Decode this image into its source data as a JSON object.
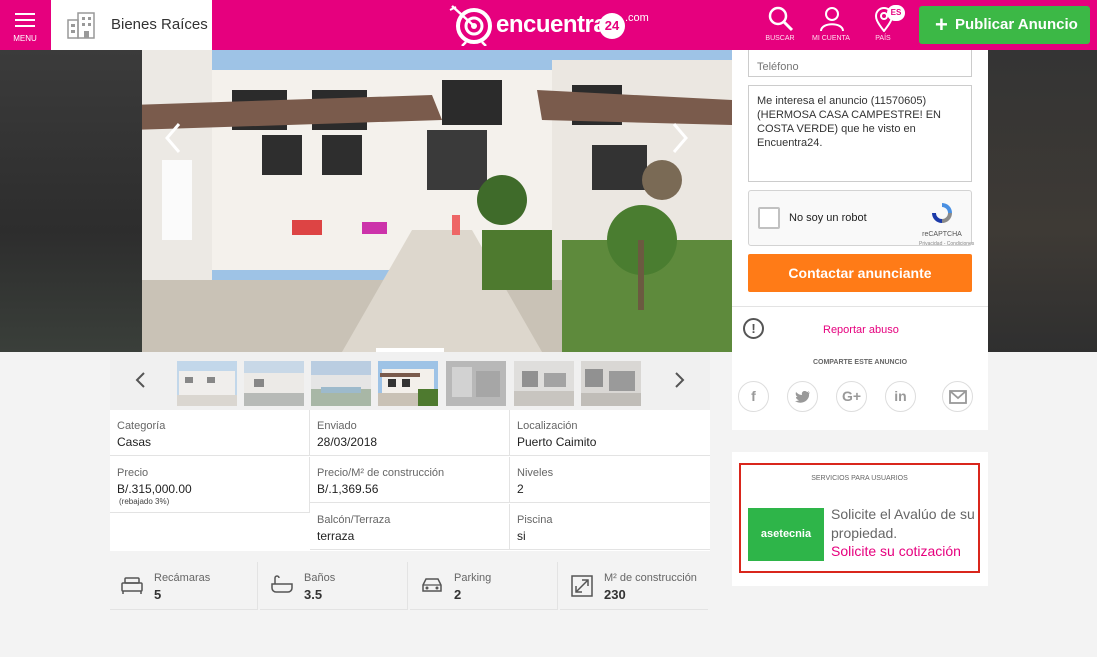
{
  "topbar": {
    "menu_label": "MENU",
    "category": "Bienes Raíces",
    "logo_word": "encuentra",
    "logo_number": "24",
    "logo_suffix": ".com",
    "search_label": "BUSCAR",
    "account_label": "MI CUENTA",
    "country_label": "PAÍS",
    "language": "ES",
    "publish_label": "Publicar Anuncio",
    "brand_color": "#e6007e"
  },
  "contact_form": {
    "phone_placeholder": "Teléfono",
    "message": "Me interesa el anuncio (11570605) (HERMOSA CASA CAMPESTRE!  EN COSTA VERDE) que he visto en Encuentra24.",
    "captcha_label": "No soy un robot",
    "captcha_brand": "reCAPTCHA",
    "captcha_links": "Privacidad - Condiciones",
    "contact_button": "Contactar anunciante",
    "report_link": "Reportar abuso"
  },
  "share": {
    "title": "COMPARTE ESTE ANUNCIO",
    "buttons": [
      "facebook-icon",
      "twitter-icon",
      "google-plus-icon",
      "linkedin-icon",
      "email-icon"
    ]
  },
  "services": {
    "title": "SERVICIOS PARA USUARIOS",
    "partner": "asetecnia",
    "description": "Solicite el Avalúo de su propiedad.",
    "cta": "Solicite su cotización"
  },
  "details": {
    "rows": [
      [
        {
          "label": "Categoría",
          "value": "Casas"
        },
        {
          "label": "Enviado",
          "value": "28/03/2018"
        },
        {
          "label": "Localización",
          "value": "Puerto Caimito"
        }
      ],
      [
        {
          "label": "Precio",
          "value": "B/.315,000.00",
          "note": "(rebajado 3%)"
        },
        {
          "label": "Precio/M² de construcción",
          "value": "B/.1,369.56"
        },
        {
          "label": "Niveles",
          "value": "2"
        }
      ],
      [
        null,
        {
          "label": "Balcón/Terraza",
          "value": "terraza"
        },
        {
          "label": "Piscina",
          "value": "si"
        }
      ]
    ]
  },
  "features": [
    {
      "icon": "bed-icon",
      "label": "Recámaras",
      "value": "5"
    },
    {
      "icon": "bathtub-icon",
      "label": "Baños",
      "value": "3.5"
    },
    {
      "icon": "car-icon",
      "label": "Parking",
      "value": "2"
    },
    {
      "icon": "area-icon",
      "label": "M² de construcción",
      "value": "230"
    }
  ]
}
